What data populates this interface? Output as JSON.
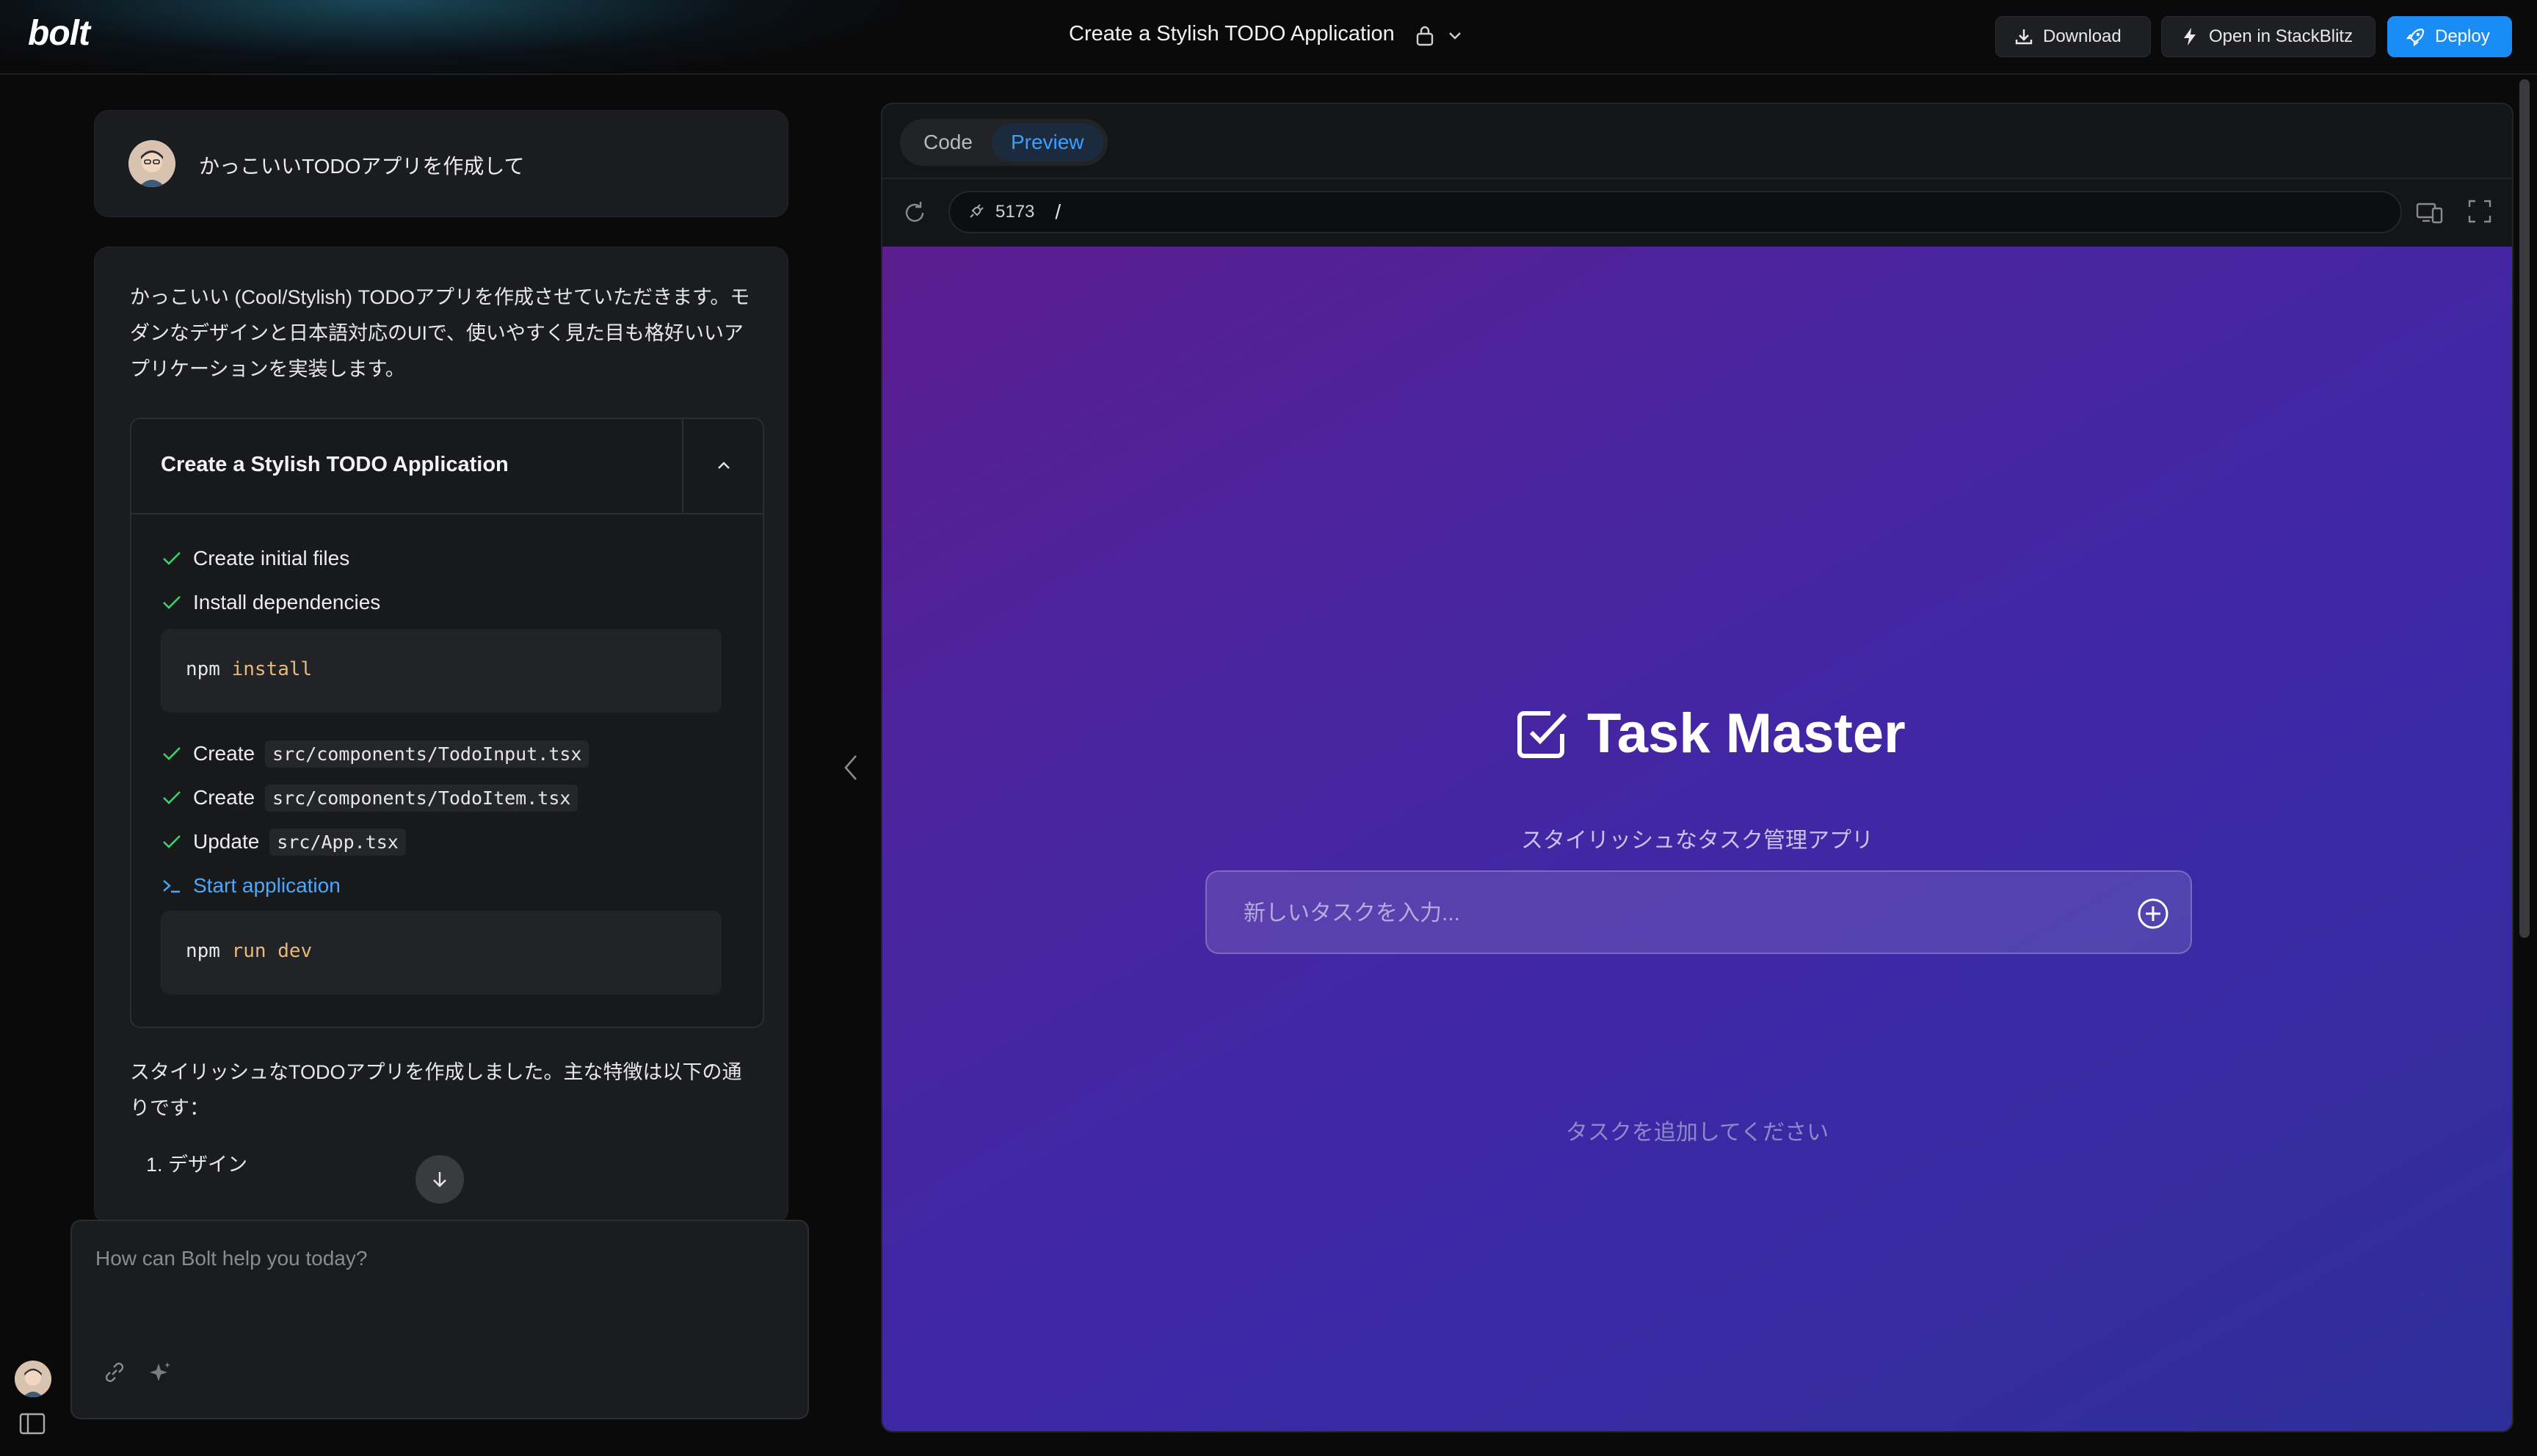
{
  "header": {
    "logo": "bolt",
    "project_title": "Create a Stylish TODO Application",
    "download_label": "Download",
    "stackblitz_label": "Open in StackBlitz",
    "deploy_label": "Deploy",
    "accent_color": "#1a8cf5"
  },
  "chat": {
    "user_message": "かっこいいTODOアプリを作成して",
    "assistant_intro": "かっこいい (Cool/Stylish) TODOアプリを作成させていただきます。モダンなデザインと日本語対応のUIで、使いやすく見た目も格好いいアプリケーションを実装します。",
    "artifact": {
      "title": "Create a Stylish TODO Application",
      "steps": {
        "s1": "Create initial files",
        "s2": "Install dependencies",
        "cmd1_cmd": "npm",
        "cmd1_arg": "install",
        "s3_verb": "Create",
        "s3_file": "src/components/TodoInput.tsx",
        "s4_verb": "Create",
        "s4_file": "src/components/TodoItem.tsx",
        "s5_verb": "Update",
        "s5_file": "src/App.tsx",
        "s6": "Start application",
        "cmd2_cmd": "npm",
        "cmd2_arg": "run dev"
      }
    },
    "summary": "スタイリッシュなTODOアプリを作成しました。主な特徴は以下の通りです：",
    "list_item_1": "1. デザイン",
    "prompt_placeholder": "How can Bolt help you today?"
  },
  "workbench": {
    "tab_code": "Code",
    "tab_preview": "Preview",
    "active_tab": "Preview",
    "port": "5173",
    "path": "/"
  },
  "preview": {
    "app_title": "Task Master",
    "subtitle": "スタイリッシュなタスク管理アプリ",
    "input_placeholder": "新しいタスクを入力...",
    "empty_message": "タスクを追加してください"
  }
}
